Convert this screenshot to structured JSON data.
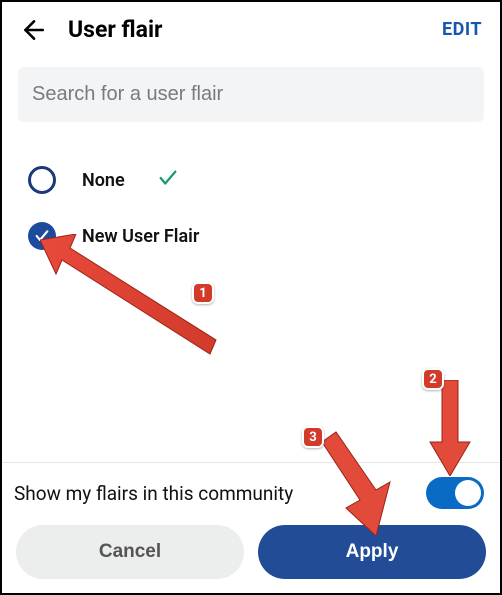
{
  "header": {
    "title": "User flair",
    "edit_label": "EDIT"
  },
  "search": {
    "placeholder": "Search for a user flair",
    "value": ""
  },
  "options": [
    {
      "label": "None",
      "selected": false,
      "hasCheckmark": true
    },
    {
      "label": "New User Flair",
      "selected": true,
      "hasCheckmark": false
    }
  ],
  "show_flairs": {
    "label": "Show my flairs in this community",
    "on": true
  },
  "buttons": {
    "cancel": "Cancel",
    "apply": "Apply"
  },
  "annotations": {
    "badge1": "1",
    "badge2": "2",
    "badge3": "3"
  }
}
